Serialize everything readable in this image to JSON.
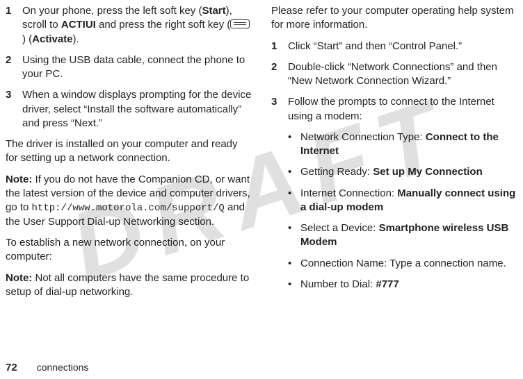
{
  "watermark": "DRAFT",
  "left": {
    "step1_num": "1",
    "step1_a": "On your phone, press the left soft key (",
    "step1_start": "Start",
    "step1_b": "), scroll to ",
    "step1_actiui": "ACTIUI",
    "step1_c": " and press the right soft key (",
    "step1_d": ") (",
    "step1_activate": "Activate",
    "step1_e": ").",
    "step2_num": "2",
    "step2": "Using the USB data cable, connect the phone to your PC.",
    "step3_num": "3",
    "step3": "When a window displays prompting for the device driver, select “Install the software automatically” and press “Next.”",
    "p1": "The driver is installed on your computer and ready for setting up a network connection.",
    "note1_label": "Note:",
    "note1_a": " If you do not have the Companion CD, or want the latest version of the device and computer drivers, go to ",
    "note1_url": "http://www.motorola.com/support/Q",
    "note1_b": " and the User Support Dial-up Networking section.",
    "p2": "To establish a new network connection, on your computer:",
    "note2_label": "Note:",
    "note2": " Not all computers have the same procedure to setup of dial-up networking."
  },
  "right": {
    "p0": "Please refer to your computer operating help system for more information.",
    "s1_num": "1",
    "s1": "Click “Start” and then “Control Panel.”",
    "s2_num": "2",
    "s2": "Double-click “Network Connections” and then “New Network Connection Wizard.”",
    "s3_num": "3",
    "s3": "Follow the prompts to connect to the Internet using a modem:",
    "b1_a": "Network Connection Type: ",
    "b1_b": "Connect to the Internet",
    "b2_a": "Getting Ready: ",
    "b2_b": "Set up My Connection",
    "b3_a": "Internet Connection: ",
    "b3_b": "Manually connect using a dial-up modem",
    "b4_a": "Select a Device: ",
    "b4_b": "Smartphone wireless USB Modem",
    "b5": "Connection Name: Type a connection name.",
    "b6_a": "Number to Dial: ",
    "b6_b": "#777"
  },
  "footer": {
    "page": "72",
    "section": "connections"
  }
}
